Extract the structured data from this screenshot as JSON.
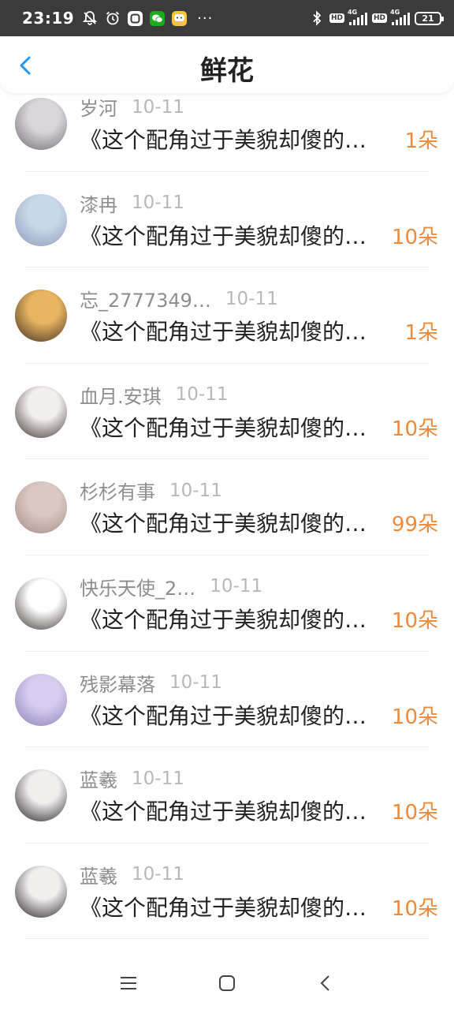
{
  "status_bar": {
    "time": "23:19",
    "left_icons": [
      "mute-bell-icon",
      "alarm-icon",
      "app-icon",
      "wechat-icon",
      "chat-app-icon"
    ],
    "more": "···",
    "hd1": "HD",
    "hd2": "HD",
    "net1": "4G",
    "net2": "4G",
    "battery": "21"
  },
  "header": {
    "title": "鲜花",
    "accent": "#2196f3"
  },
  "items": [
    {
      "name": "岁河",
      "date": "10-11",
      "message": "《这个配角过于美貌却傻的…",
      "amount": "1朵",
      "avatar_colors": [
        "#d9d6dc",
        "#6e6a70"
      ]
    },
    {
      "name": "漆冉",
      "date": "10-11",
      "message": "《这个配角过于美貌却傻的…",
      "amount": "10朵",
      "avatar_colors": [
        "#c9d8ea",
        "#8e97b8"
      ]
    },
    {
      "name": "忘_2777349…",
      "date": "10-11",
      "message": "《这个配角过于美貌却傻的…",
      "amount": "1朵",
      "avatar_colors": [
        "#e8b560",
        "#3b2a22"
      ]
    },
    {
      "name": "血月.安琪",
      "date": "10-11",
      "message": "《这个配角过于美貌却傻的…",
      "amount": "10朵",
      "avatar_colors": [
        "#f2eeee",
        "#3c2c2c"
      ]
    },
    {
      "name": "杉杉有事",
      "date": "10-11",
      "message": "《这个配角过于美貌却傻的…",
      "amount": "99朵",
      "avatar_colors": [
        "#d9c9c2",
        "#a48c85"
      ]
    },
    {
      "name": "快乐天使_2…",
      "date": "10-11",
      "message": "《这个配角过于美貌却傻的…",
      "amount": "10朵",
      "avatar_colors": [
        "#ffffff",
        "#3a3030"
      ]
    },
    {
      "name": "残影幕落",
      "date": "10-11",
      "message": "《这个配角过于美貌却傻的…",
      "amount": "10朵",
      "avatar_colors": [
        "#d8cdef",
        "#8a7fb6"
      ]
    },
    {
      "name": "蓝羲",
      "date": "10-11",
      "message": "《这个配角过于美貌却傻的…",
      "amount": "10朵",
      "avatar_colors": [
        "#f1eeee",
        "#1f1c1f"
      ]
    },
    {
      "name": "蓝羲",
      "date": "10-11",
      "message": "《这个配角过于美貌却傻的…",
      "amount": "10朵",
      "avatar_colors": [
        "#f1eeee",
        "#1f1c1f"
      ]
    }
  ],
  "nav_bar": {
    "icons": [
      "menu-icon",
      "home-square-icon",
      "back-chevron-icon"
    ]
  }
}
